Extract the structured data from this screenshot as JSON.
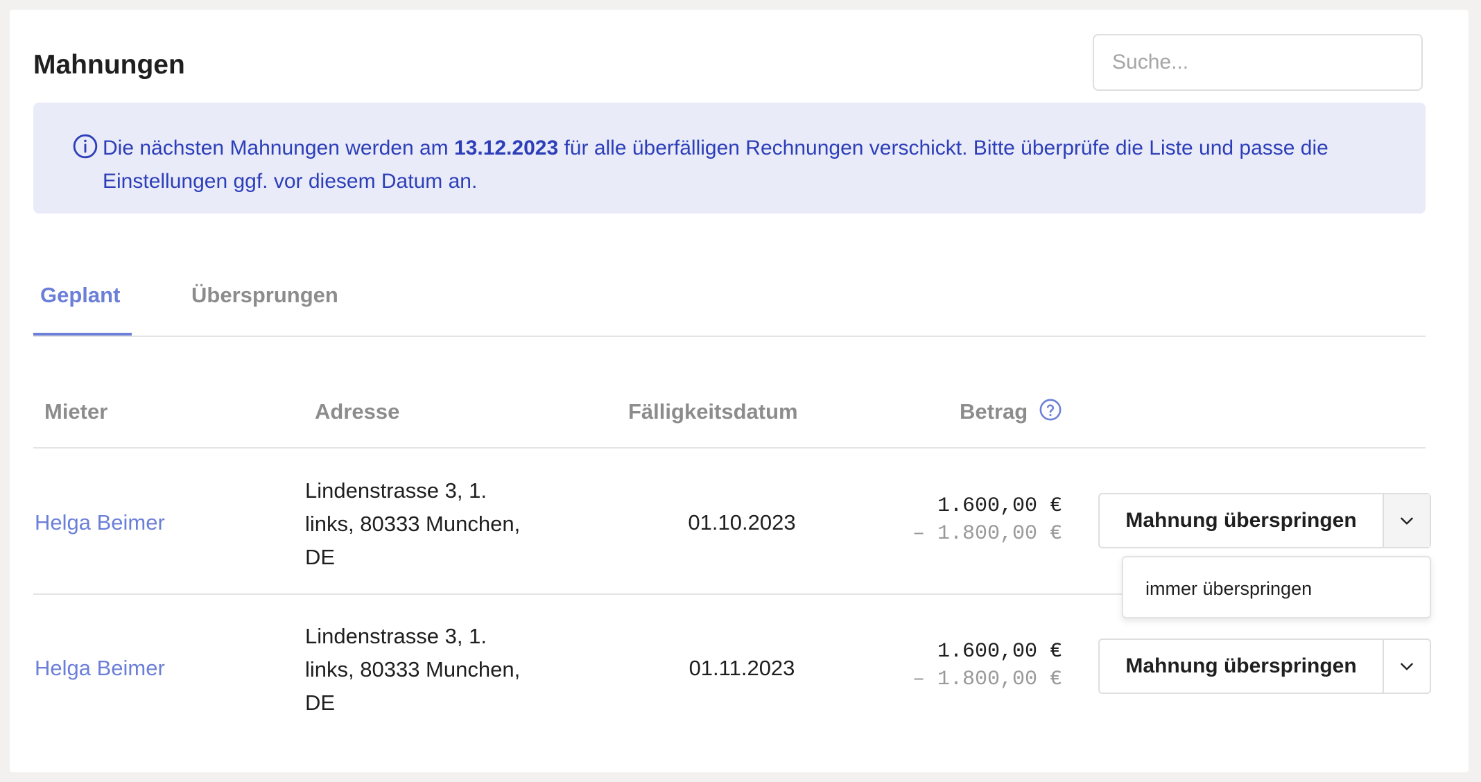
{
  "header": {
    "title": "Mahnungen",
    "search_placeholder": "Suche..."
  },
  "info_banner": {
    "icon": "info-icon",
    "text_before": "Die nächsten Mahnungen werden am ",
    "date": "13.12.2023",
    "text_after": " für alle überfälligen Rechnungen verschickt. Bitte überprüfe die Liste und passe die Einstellungen ggf. vor diesem Datum an."
  },
  "tabs": [
    {
      "label": "Geplant",
      "active": true
    },
    {
      "label": "Übersprungen",
      "active": false
    }
  ],
  "table": {
    "columns": {
      "tenant": "Mieter",
      "address": "Adresse",
      "due_date": "Fälligkeitsdatum",
      "amount": "Betrag"
    },
    "rows": [
      {
        "tenant": "Helga Beimer",
        "address": "Lindenstrasse 3, 1. links, 80333 Munchen, DE",
        "due_date": "01.10.2023",
        "amount": "1.600,00 €",
        "amount_secondary": "– 1.800,00 €",
        "action_label": "Mahnung überspringen"
      },
      {
        "tenant": "Helga Beimer",
        "address": "Lindenstrasse 3, 1. links, 80333 Munchen, DE",
        "due_date": "01.11.2023",
        "amount": "1.600,00 €",
        "amount_secondary": "– 1.800,00 €",
        "action_label": "Mahnung überspringen"
      }
    ]
  },
  "dropdown": {
    "item_label": "immer überspringen"
  },
  "colors": {
    "accent": "#6b7fd8",
    "info_bg": "#e9ebf9",
    "info_text": "#2d3fb8"
  }
}
